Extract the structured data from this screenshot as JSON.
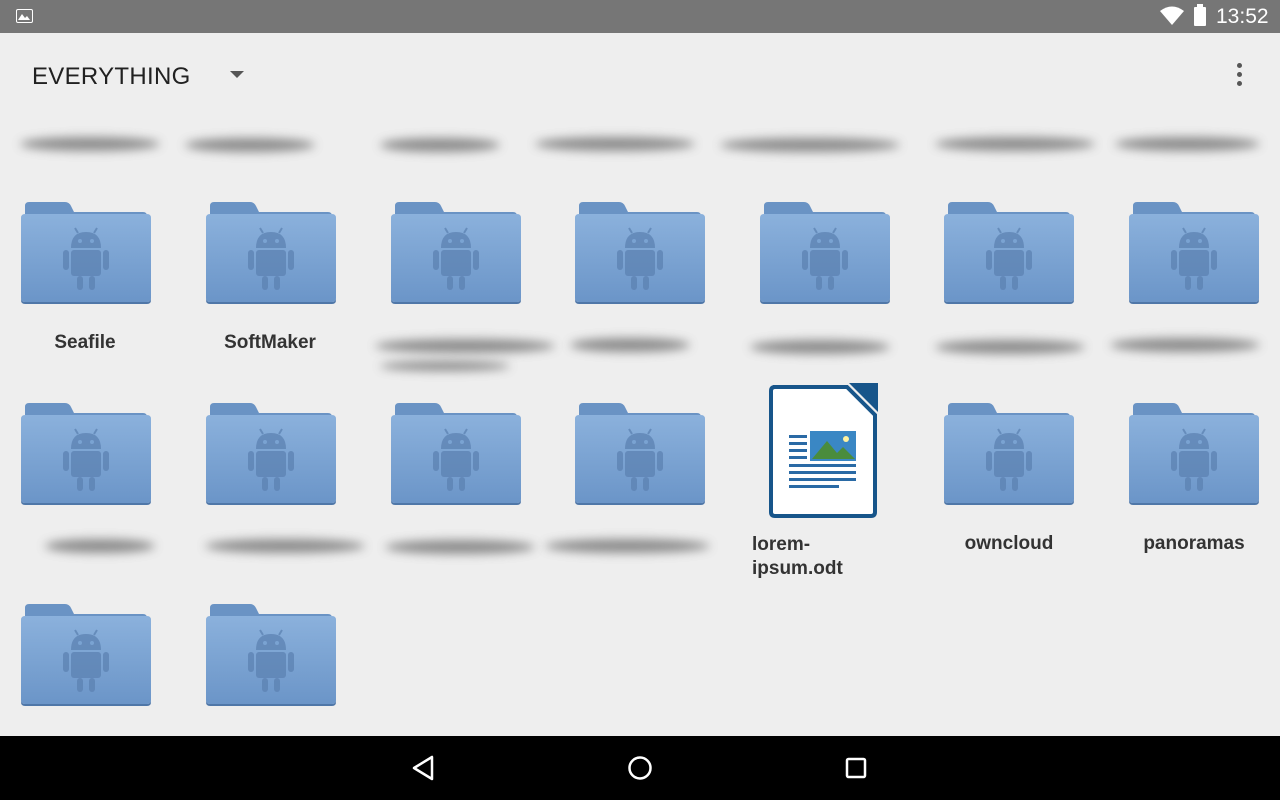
{
  "status_bar": {
    "time": "13:52",
    "icons": [
      "image-notification-icon",
      "wifi-icon",
      "battery-icon"
    ]
  },
  "toolbar": {
    "filter_label": "EVERYTHING",
    "icons": [
      "dropdown-arrow-icon",
      "overflow-menu-icon"
    ]
  },
  "items": [
    {
      "name": "",
      "type": "folder",
      "label_visible": false
    },
    {
      "name": "",
      "type": "folder",
      "label_visible": false
    },
    {
      "name": "",
      "type": "folder",
      "label_visible": false
    },
    {
      "name": "",
      "type": "folder",
      "label_visible": false
    },
    {
      "name": "",
      "type": "folder",
      "label_visible": false
    },
    {
      "name": "",
      "type": "folder",
      "label_visible": false
    },
    {
      "name": "",
      "type": "folder",
      "label_visible": false
    },
    {
      "name": "Seafile",
      "type": "folder"
    },
    {
      "name": "SoftMaker",
      "type": "folder"
    },
    {
      "name": "",
      "type": "folder",
      "label_visible": false
    },
    {
      "name": "",
      "type": "folder",
      "label_visible": false
    },
    {
      "name": "lorem-ipsum.odt",
      "type": "document",
      "label_lines": [
        "lorem-",
        "ipsum.odt"
      ]
    },
    {
      "name": "owncloud",
      "type": "folder"
    },
    {
      "name": "panoramas",
      "type": "folder"
    },
    {
      "name": "",
      "type": "folder",
      "label_visible": false
    },
    {
      "name": "",
      "type": "folder",
      "label_visible": false
    }
  ],
  "labels": {
    "seafile": "Seafile",
    "softmaker": "SoftMaker",
    "lorem_line1": "lorem-",
    "lorem_line2": "ipsum.odt",
    "owncloud": "owncloud",
    "panoramas": "panoramas"
  },
  "nav_bar": {
    "buttons": [
      "back-icon",
      "home-icon",
      "recents-icon"
    ]
  },
  "colors": {
    "folder_body": "#7aa3d2",
    "folder_tab": "#6a93c4",
    "folder_android": "#5c82b2",
    "status_bar": "#767676",
    "background": "#eeeeee"
  }
}
